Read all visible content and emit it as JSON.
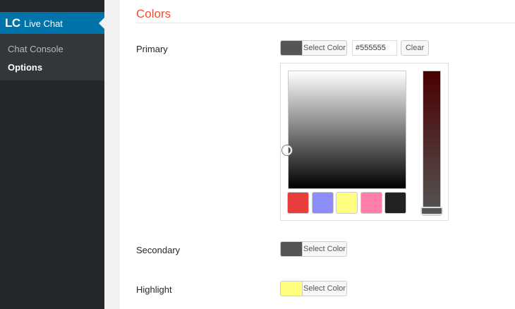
{
  "sidebar": {
    "current": {
      "logo": "LC",
      "label": "Live Chat"
    },
    "items": [
      {
        "label": "Chat Console",
        "current": false
      },
      {
        "label": "Options",
        "current": true
      }
    ]
  },
  "section": {
    "title": "Colors"
  },
  "rows": {
    "primary": {
      "label": "Primary",
      "color": "#555555",
      "button_label": "Select Color",
      "hex_value": "#555555",
      "clear_label": "Clear"
    },
    "secondary": {
      "label": "Secondary",
      "color": "#555555",
      "button_label": "Select Color"
    },
    "highlight": {
      "label": "Highlight",
      "color": "#ffff7f",
      "button_label": "Select Color"
    }
  },
  "picker": {
    "palette": [
      "#e93c3c",
      "#8c8cff",
      "#ffff7f",
      "#ff7fa8",
      "#222222"
    ]
  },
  "colors": {
    "accent": "#e8542c",
    "sidebar": "#23282d",
    "active_menu": "#0073aa"
  }
}
